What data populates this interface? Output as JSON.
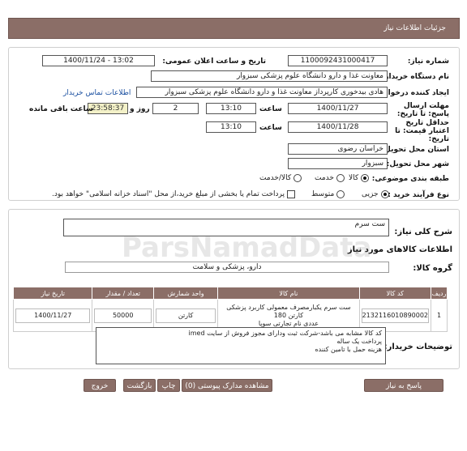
{
  "header": {
    "title": "جزئیات اطلاعات نیاز"
  },
  "fields": {
    "need_number_label": "شماره نیاز:",
    "need_number": "1100092431000417",
    "announce_label": "تاریخ و ساعت اعلان عمومی:",
    "announce_value": "1400/11/24 - 13:02",
    "buyer_label": "نام دستگاه خریدار:",
    "buyer_value": "معاونت غذا و دارو   دانشگاه علوم پزشکی سبزوار",
    "creator_label": "ایجاد کننده درخواست:",
    "creator_value": "هادی بیدخوری کارپرداز معاونت غذا و دارو   دانشگاه علوم پزشکی سبزوار",
    "contact_link": "اطلاعات تماس خریدار",
    "send_deadline_label": "مهلت ارسال پاسخ: تا تاریخ:",
    "send_date": "1400/11/27",
    "time_label": "ساعت",
    "send_time": "13:10",
    "days_value": "2",
    "days_label": "روز و",
    "timer": "23:58:37",
    "remaining_label": "ساعت باقی مانده",
    "price_validity_label": "حداقل تاریخ اعتبار قیمت: تا تاریخ:",
    "price_date": "1400/11/28",
    "price_time": "13:10",
    "province_label": "استان محل تحویل:",
    "province_value": "خراسان رضوی",
    "city_label": "شهر محل تحویل:",
    "city_value": "سبزوار",
    "category_label": "طبقه بندی موضوعی:",
    "category_options": [
      "کالا",
      "خدمت",
      "کالا/خدمت"
    ],
    "process_label": "نوع فرآیند خرید :",
    "process_options": [
      "جزیی",
      "متوسط"
    ],
    "payment_note": "پرداخت تمام یا بخشی از مبلغ خرید،از محل \"اسناد خزانه اسلامی\" خواهد بود."
  },
  "summary": {
    "label": "شرح کلی نیاز:",
    "value": "ست سرم"
  },
  "goods": {
    "section_title": "اطلاعات کالاهای مورد نیاز",
    "group_label": "گروه کالا:",
    "group_value": "دارو، پزشکی و سلامت",
    "columns": [
      "ردیف",
      "کد کالا",
      "نام کالا",
      "واحد شمارش",
      "تعداد / مقدار",
      "تاریخ نیاز"
    ],
    "rows": [
      {
        "index": "1",
        "code": "2132116010890002",
        "name_line1": "ست سرم یکبارمصرف معمولی کاربرد پزشکی کارتن 180",
        "name_line2": "عددی نام تجارتی سوپا",
        "unit": "کارتن",
        "qty": "50000",
        "date": "1400/11/27"
      }
    ]
  },
  "buyer_notes": {
    "label": "توضیحات خریدار:",
    "line1": "کد کالا مشابه می باشد-شرکت ثبت ودارای مجوز فروش از سایت imed",
    "line2": "پرداخت یک ساله",
    "line3": "هزینه حمل با تامین کننده"
  },
  "buttons": {
    "reply": "پاسخ به نیاز",
    "attachments": "مشاهده مدارک پیوستی (0)",
    "print": "چاپ",
    "back": "بازگشت",
    "exit": "خروج"
  },
  "watermark": {
    "text": "ParsNamadData"
  }
}
